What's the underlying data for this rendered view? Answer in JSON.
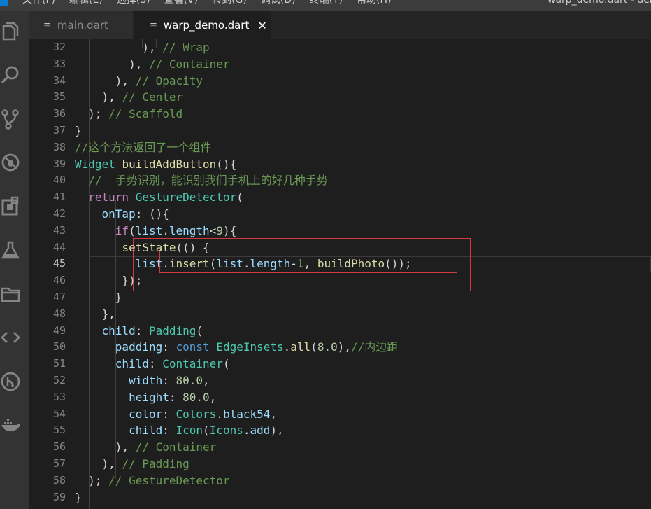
{
  "menubar": {
    "menus": [
      "文件(F)",
      "编辑(E)",
      "选择(S)",
      "查看(V)",
      "转到(G)",
      "调试(D)",
      "终端(T)",
      "帮助(H)"
    ],
    "title": "warp_demo.dart - dem"
  },
  "activity_bar": {
    "icons": [
      "explorer-icon",
      "search-icon",
      "source-control-icon",
      "debug-icon",
      "extensions-icon",
      "flask-icon",
      "folder-icon",
      "code-icon",
      "git-history-icon",
      "docker-icon"
    ]
  },
  "tabs": [
    {
      "label": "main.dart",
      "active": false
    },
    {
      "label": "warp_demo.dart",
      "active": true,
      "close": "✕"
    }
  ],
  "editor": {
    "active_line": 45,
    "lines": [
      {
        "num": "32",
        "text": "          ), // Wrap"
      },
      {
        "num": "33",
        "text": "        ), // Container"
      },
      {
        "num": "34",
        "text": "      ), // Opacity"
      },
      {
        "num": "35",
        "text": "    ), // Center"
      },
      {
        "num": "36",
        "text": "  ); // Scaffold"
      },
      {
        "num": "37",
        "text": "}"
      },
      {
        "num": "38",
        "text": "//这个方法返回了一个组件"
      },
      {
        "num": "39",
        "text": "Widget buildAddButton(){"
      },
      {
        "num": "40",
        "text": "  //  手势识别，能识别我们手机上的好几种手势"
      },
      {
        "num": "41",
        "text": "  return GestureDetector("
      },
      {
        "num": "42",
        "text": "    onTap: (){"
      },
      {
        "num": "43",
        "text": "      if(list.length<9){"
      },
      {
        "num": "44",
        "text": "       setState(() {"
      },
      {
        "num": "45",
        "text": "         list.insert(list.length-1, buildPhoto());"
      },
      {
        "num": "46",
        "text": "       });"
      },
      {
        "num": "47",
        "text": "      }"
      },
      {
        "num": "48",
        "text": "    },"
      },
      {
        "num": "49",
        "text": "    child: Padding("
      },
      {
        "num": "50",
        "text": "      padding: const EdgeInsets.all(8.0),//内边距"
      },
      {
        "num": "51",
        "text": "      child: Container("
      },
      {
        "num": "52",
        "text": "        width: 80.0,"
      },
      {
        "num": "53",
        "text": "        height: 80.0,"
      },
      {
        "num": "54",
        "text": "        color: Colors.black54,"
      },
      {
        "num": "55",
        "text": "        child: Icon(Icons.add),"
      },
      {
        "num": "56",
        "text": "      ), // Container"
      },
      {
        "num": "57",
        "text": "    ), // Padding"
      },
      {
        "num": "58",
        "text": "  ); // GestureDetector"
      },
      {
        "num": "59",
        "text": "}"
      }
    ]
  },
  "colors": {
    "keyword": "#569cd6",
    "control_keyword": "#c586c0",
    "type": "#4ec9b0",
    "function": "#dcdcaa",
    "variable": "#9cdcfe",
    "number": "#b5cea8",
    "comment": "#6a9955",
    "annotation_box": "#d0393e"
  }
}
